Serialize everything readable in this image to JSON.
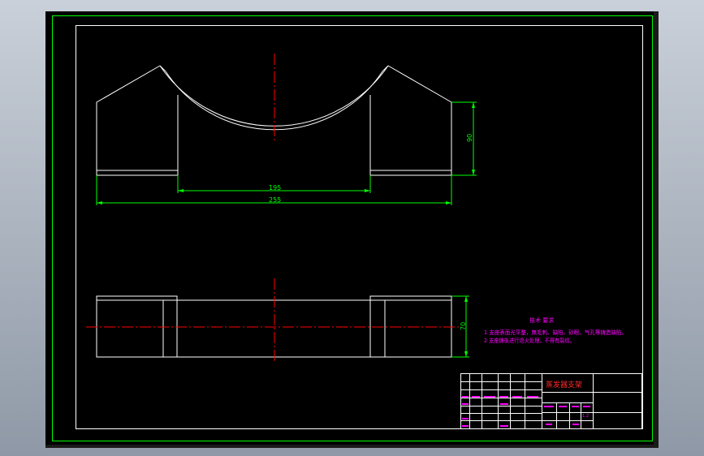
{
  "front_view": {
    "dims": {
      "d195": "195",
      "d255": "255",
      "d90": "90"
    }
  },
  "top_view": {
    "dims": {
      "d70": "70"
    }
  },
  "tech_notes": {
    "heading": "技术 要求",
    "line1": "1 支座表面光平整，無毛刺、缺陷、砂眼、气孔等铸造缺陷。",
    "line2": "2 支座铸後进行退火处理，不得有裂纹。"
  },
  "title_block": {
    "part_name": "蒸发器支架",
    "scale": "1:2"
  },
  "colors": {
    "background": "#000000",
    "border": "#00ff00",
    "outline": "#ffffff",
    "centerline": "#ff0000",
    "notes": "#ff00ff"
  }
}
